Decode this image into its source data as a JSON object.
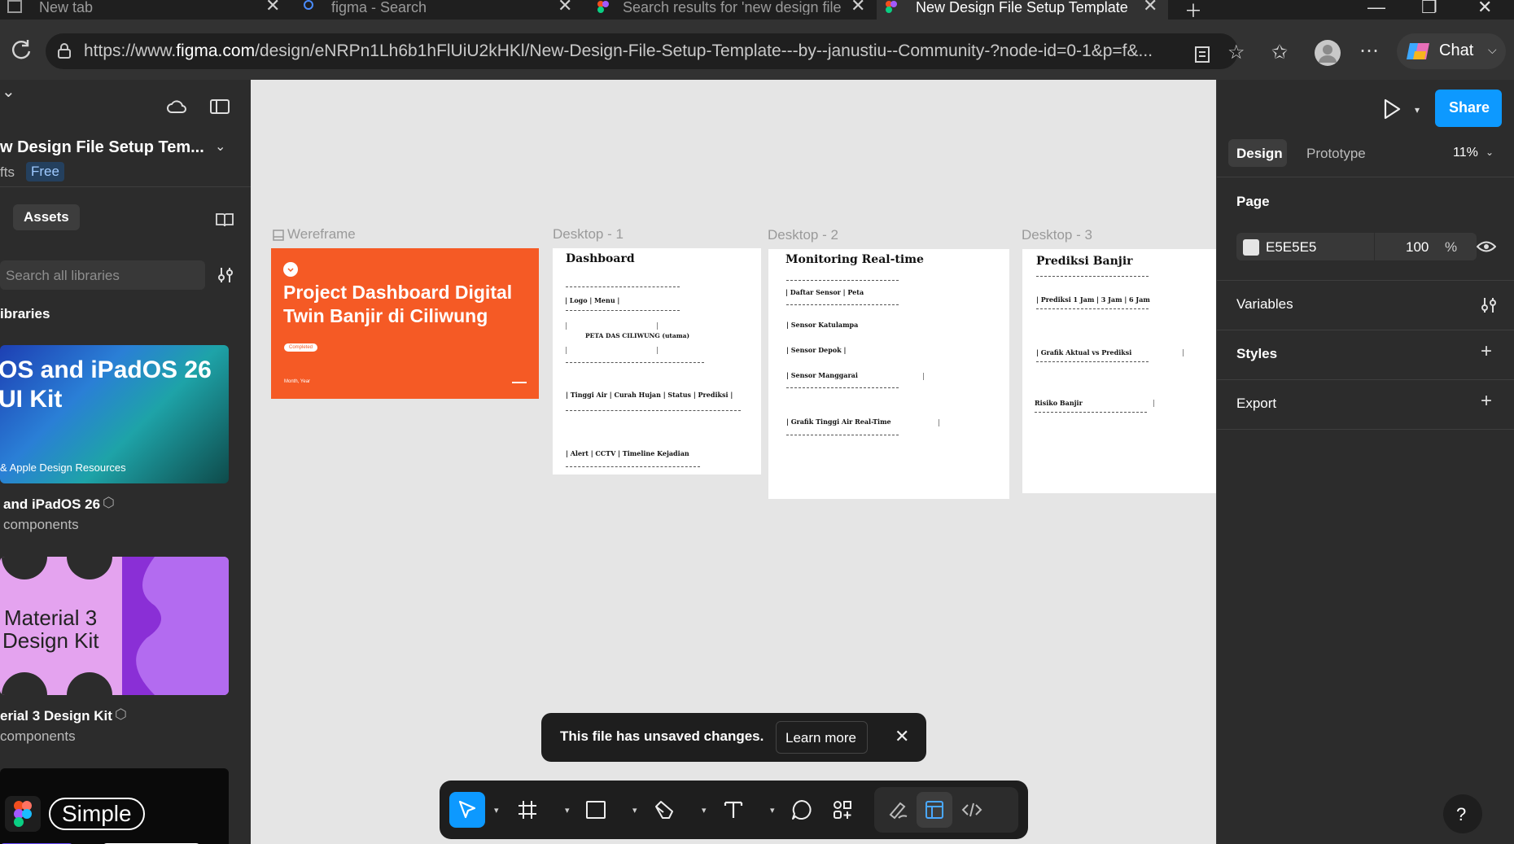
{
  "browser": {
    "tabs": [
      {
        "title": "New tab"
      },
      {
        "title": "figma - Search"
      },
      {
        "title": "Search results for 'new design file'"
      },
      {
        "title": "New Design File Setup Template -"
      }
    ],
    "url_prefix": "https://www.",
    "url_domain": "figma.com",
    "url_rest": "/design/eNRPn1Lh6b1hFlUiU2kHKl/New-Design-File-Setup-Template---by--janustiu--Community-?node-id=0-1&p=f&...",
    "chat_label": "Chat"
  },
  "left_panel": {
    "file_title": "w Design File Setup Tem...",
    "drafts_label": "fts",
    "plan_badge": "Free",
    "assets_tab": "Assets",
    "search_placeholder": "Search all libraries",
    "libraries_heading": "ibraries",
    "libraries": [
      {
        "thumb_line1": "OS and iPadOS 26",
        "thumb_line2": "UI Kit",
        "thumb_tag": "& Apple Design Resources",
        "name": "and iPadOS 26",
        "count": "components"
      },
      {
        "thumb_line1": "Material 3",
        "thumb_line2": "Design Kit",
        "name": "erial 3 Design Kit",
        "count": "components"
      },
      {
        "thumb_label": "Simple"
      }
    ]
  },
  "canvas": {
    "frames": [
      {
        "label": "Wereframe",
        "title": "Project Dashboard Digital Twin Banjir di Ciliwung",
        "badge": "Completed",
        "footer_left": "Month, Year"
      },
      {
        "label": "Desktop - 1",
        "heading": "Dashboard",
        "lines": [
          "| Logo | Menu |",
          "PETA DAS CILIWUNG (utama)",
          "| Tinggi Air | Curah Hujan | Status | Prediksi |",
          "| Alert | CCTV | Timeline Kejadian"
        ]
      },
      {
        "label": "Desktop - 2",
        "heading": "Monitoring Real-time",
        "lines": [
          "| Daftar Sensor | Peta",
          "| Sensor Katulampa",
          "| Sensor Depok |",
          "| Sensor Manggarai",
          "| Grafik Tinggi Air Real-Time"
        ]
      },
      {
        "label": "Desktop - 3",
        "heading": "Prediksi Banjir",
        "lines": [
          "| Prediksi 1 Jam | 3 Jam | 6 Jam",
          "| Grafik Aktual vs Prediksi",
          "Risiko Banjir"
        ]
      }
    ]
  },
  "right_panel": {
    "share_label": "Share",
    "tabs": [
      "Design",
      "Prototype"
    ],
    "zoom": "11%",
    "page_heading": "Page",
    "page_color_hex": "E5E5E5",
    "page_opacity": "100",
    "percent_sign": "%",
    "sections": [
      "Variables",
      "Styles",
      "Export"
    ]
  },
  "toast": {
    "message": "This file has unsaved changes.",
    "action": "Learn more"
  },
  "toolbar": {
    "tools": [
      "move-tool",
      "frame-tool",
      "shape-tool",
      "pen-tool",
      "text-tool",
      "comment-tool",
      "actions-tool",
      "draw-mode",
      "design-mode",
      "dev-mode"
    ]
  },
  "help_label": "?",
  "colors": {
    "accent": "#0d99ff",
    "frame_orange": "#f55a25",
    "panel": "#2c2c2c",
    "canvas": "#e5e5e5"
  }
}
